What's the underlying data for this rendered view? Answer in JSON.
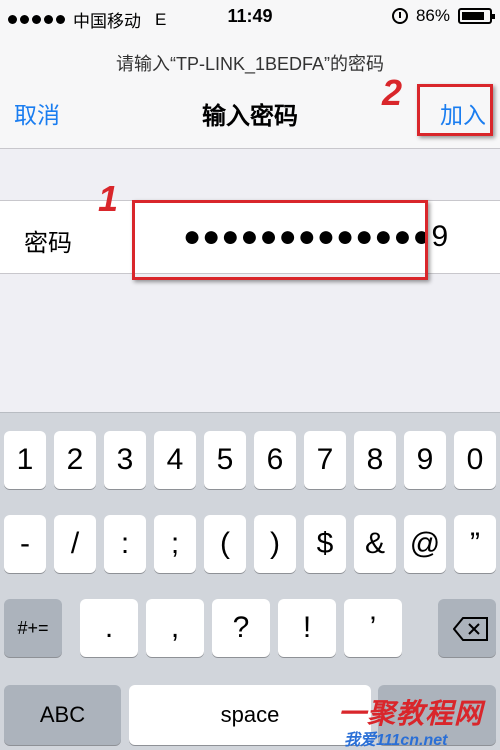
{
  "status_bar": {
    "carrier": "中国移动",
    "network": "E",
    "time": "11:49",
    "battery": "86%",
    "battery_fraction": 0.86,
    "icons": [
      "signal-dots",
      "alarm-icon",
      "battery-icon"
    ]
  },
  "nav": {
    "prompt": "请输入“TP-LINK_1BEDFA”的密码",
    "cancel": "取消",
    "title": "输入密码",
    "join": "加入"
  },
  "password": {
    "label": "密码",
    "value": "●●●●●●●●●●●●●9"
  },
  "annotations": {
    "step1": "1",
    "step2": "2",
    "color": "#d9262b"
  },
  "keyboard": {
    "row1": [
      "1",
      "2",
      "3",
      "4",
      "5",
      "6",
      "7",
      "8",
      "9",
      "0"
    ],
    "row2": [
      "-",
      "/",
      ":",
      ";",
      "(",
      ")",
      "$",
      "&",
      "@",
      "”"
    ],
    "row3_left": "#+=",
    "row3": [
      ".",
      ",",
      "?",
      "!",
      "’"
    ],
    "abc": "ABC",
    "space": "space"
  },
  "watermark": {
    "main": "一聚教程网",
    "sub": "我爱111cn.net"
  },
  "colors": {
    "ios_blue": "#1a7df0",
    "keyboard_bg": "#d1d5db"
  }
}
